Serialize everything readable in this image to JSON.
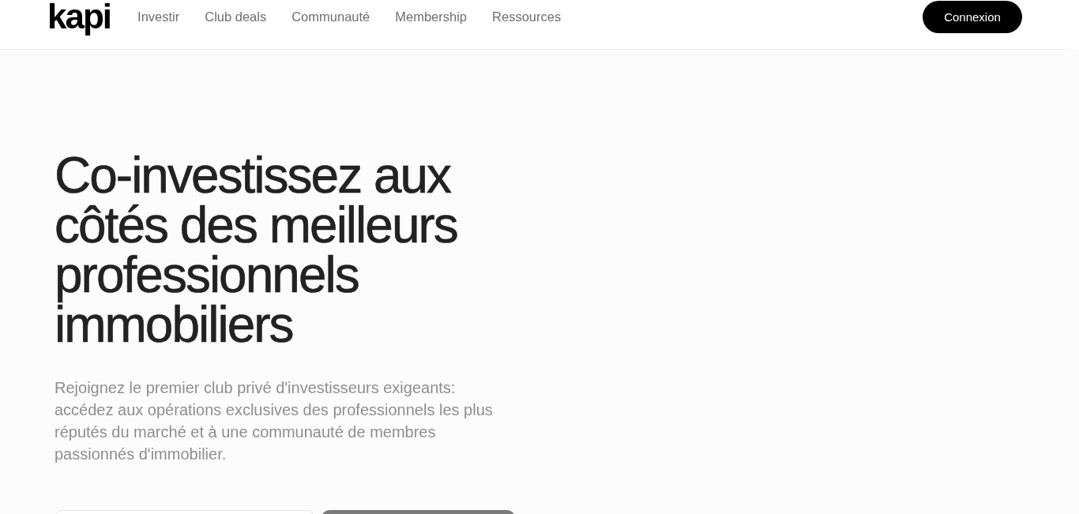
{
  "header": {
    "logo": "kapi",
    "nav": [
      {
        "label": "Investir"
      },
      {
        "label": "Club deals"
      },
      {
        "label": "Communauté"
      },
      {
        "label": "Membership"
      },
      {
        "label": "Ressources"
      }
    ],
    "login_button": "Connexion"
  },
  "hero": {
    "title": "Co-investissez aux côtés des meilleurs professionnels immobiliers",
    "subtitle": "Rejoignez le premier club privé d'investisseurs exigeants: accédez aux opérations exclusives des professionnels les plus réputés du marché et à une communauté de membres passionnés d'immobilier."
  }
}
